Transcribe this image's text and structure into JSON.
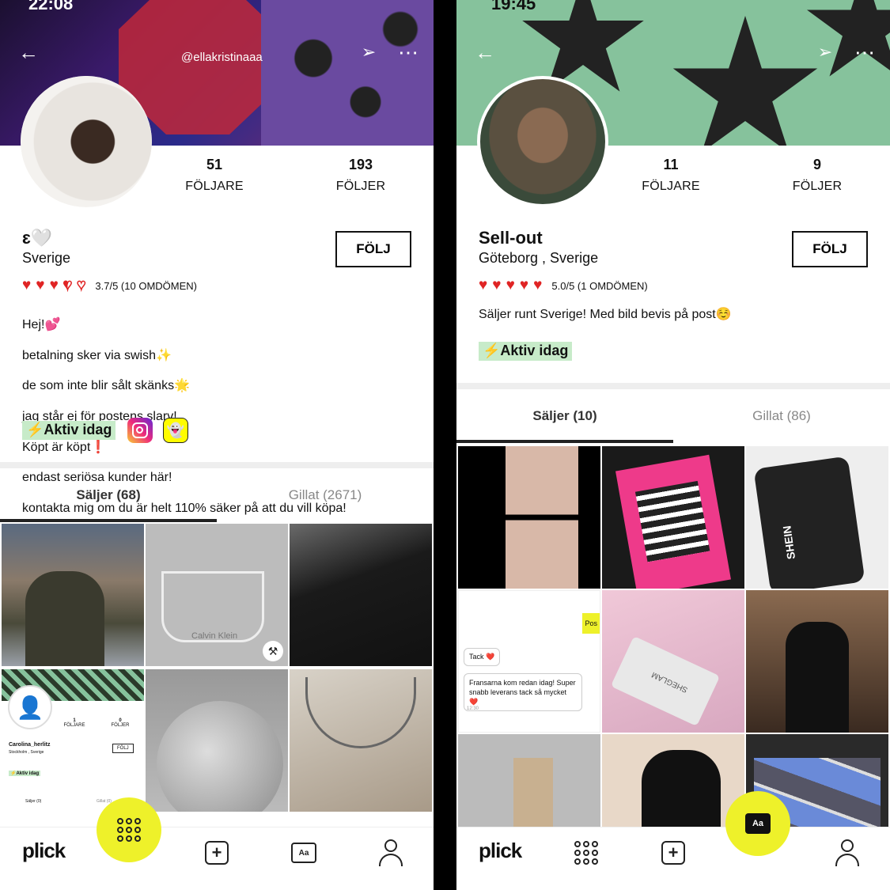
{
  "left_profile": {
    "status_time": "22:08",
    "handle": "@ellakristinaaa",
    "followers_count": "51",
    "followers_label": "FÖLJARE",
    "following_count": "193",
    "following_label": "FÖLJER",
    "name": "ɛ🤍",
    "location": "Sverige",
    "follow_label": "FÖLJ",
    "rating_text": "3.7/5 (10 OMDÖMEN)",
    "rating_value": 3.7,
    "bio_lines": [
      "Hej!💕",
      "betalning sker via swish✨",
      "de som inte blir sålt skänks🌟",
      "jag står ej för postens slarv!",
      "Köpt är köpt❗",
      "endast seriösa kunder här!",
      "kontakta mig om du är helt 110% säker på att du vill köpa!"
    ],
    "active_label": "⚡Aktiv idag",
    "tab_selling": "Säljer (68)",
    "tab_liked": "Gillat (2671)",
    "grid_cells": [
      {
        "alt": "mirror selfie puffer jacket"
      },
      {
        "alt": "Calvin Klein bralette",
        "text": "Calvin Klein"
      },
      {
        "alt": "black sweater"
      },
      {
        "alt": "profile screenshot"
      },
      {
        "alt": "earrings on mirror"
      },
      {
        "alt": "silver necklace"
      }
    ],
    "mini_profile": {
      "name": "Carolina_herlitz",
      "location": "Stockholm , Sverige",
      "followers": "1",
      "following": "0",
      "followers_label": "FÖLJARE",
      "following_label": "FÖLJER",
      "follow": "FÖLJ",
      "active": "⚡Aktiv idag",
      "tab_selling": "Säljer (0)",
      "tab_liked": "Gillat (0)"
    }
  },
  "right_profile": {
    "status_time": "19:45",
    "followers_count": "11",
    "followers_label": "FÖLJARE",
    "following_count": "9",
    "following_label": "FÖLJER",
    "name": "Sell-out",
    "location": "Göteborg , Sverige",
    "follow_label": "FÖLJ",
    "rating_text": "5.0/5 (1 OMDÖMEN)",
    "rating_value": 5.0,
    "bio": "Säljer runt Sverige! Med bild bevis på post☺️",
    "active_label": "⚡Aktiv idag",
    "tab_selling": "Säljer (10)",
    "tab_liked": "Gillat (86)",
    "chat_preview": {
      "bubble_right": "Pos",
      "msg1": "Tack ❤️",
      "msg2": "Fransarna kom redan idag! Super snabb leverans tack så mycket ❤️",
      "time": "12:30"
    },
    "shein_text": "SHEIN",
    "sheglam_text": "SHEGLAM"
  },
  "nav": {
    "logo": "plick",
    "chat_label": "Aa"
  },
  "colors": {
    "accent_yellow": "#eef12a",
    "heart_red": "#e02424",
    "active_green": "#c7ebc9",
    "banner_green": "#86c29c"
  }
}
